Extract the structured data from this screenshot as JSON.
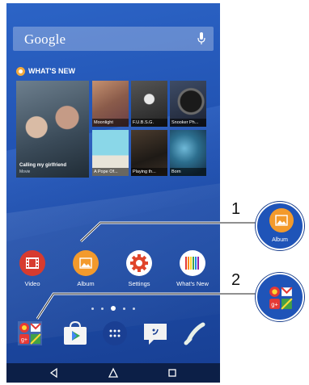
{
  "search": {
    "logo": "Google"
  },
  "whats_new": {
    "header": "WHAT'S NEW",
    "feature": {
      "title": "Calling my girlfriend",
      "subtitle": "Movie"
    },
    "tiles": [
      {
        "label": "Moonlight"
      },
      {
        "label": "F.U.B.S.G."
      },
      {
        "label": "Snooker Ph..."
      },
      {
        "label": "A Pope Of..."
      },
      {
        "label": "Playing th..."
      },
      {
        "label": "Born"
      }
    ]
  },
  "apps": [
    {
      "label": "Video",
      "icon": "video-film-icon",
      "color": "#d73b2f"
    },
    {
      "label": "Album",
      "icon": "album-picture-icon",
      "color": "#f39a2c"
    },
    {
      "label": "Settings",
      "icon": "gear-icon",
      "color": "#ffffff"
    },
    {
      "label": "What's New",
      "icon": "whats-new-icon",
      "color": "#ffffff"
    }
  ],
  "page_indicator": {
    "pages": 5,
    "current": 3
  },
  "dock": [
    {
      "icon": "google-apps-folder-icon"
    },
    {
      "icon": "play-store-icon"
    },
    {
      "icon": "app-drawer-icon"
    },
    {
      "icon": "messaging-icon"
    },
    {
      "icon": "phone-icon"
    }
  ],
  "navbar": [
    "back-icon",
    "home-icon",
    "recents-icon"
  ],
  "callouts": [
    {
      "number": "1",
      "label": "Album"
    },
    {
      "number": "2",
      "label": ""
    }
  ]
}
